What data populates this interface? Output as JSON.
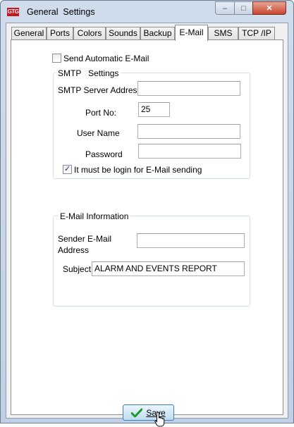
{
  "window": {
    "title": "General  Settings",
    "app_icon_text": "GTG",
    "controls": {
      "minimize": "–",
      "maximize": "□",
      "close": "✕"
    }
  },
  "tabs": [
    {
      "label": "General"
    },
    {
      "label": "Ports"
    },
    {
      "label": "Colors"
    },
    {
      "label": "Sounds"
    },
    {
      "label": "Backup"
    },
    {
      "label": "E-Mail"
    },
    {
      "label": "SMS"
    },
    {
      "label": "TCP /IP"
    }
  ],
  "active_tab": "E-Mail",
  "email": {
    "send_automatic": {
      "label": "Send Automatic E-Mail",
      "checked": false
    },
    "smtp": {
      "group_title": "SMTP   Settings",
      "server_label": "SMTP Server Address",
      "server_value": "",
      "port_label": "Port No:",
      "port_value": "25",
      "username_label": "User Name",
      "username_value": "",
      "password_label": "Password",
      "password_value": "",
      "login_required": {
        "label": "It must be login for E-Mail sending",
        "checked": true,
        "mark": "✓"
      }
    },
    "info": {
      "group_title": "E-Mail Information",
      "sender_label_line1": "Sender E-Mail",
      "sender_label_line2": "Address",
      "sender_value": "",
      "subject_label": "Subject",
      "subject_value": "ALARM AND EVENTS REPORT"
    }
  },
  "save_button": {
    "label": "Save"
  }
}
